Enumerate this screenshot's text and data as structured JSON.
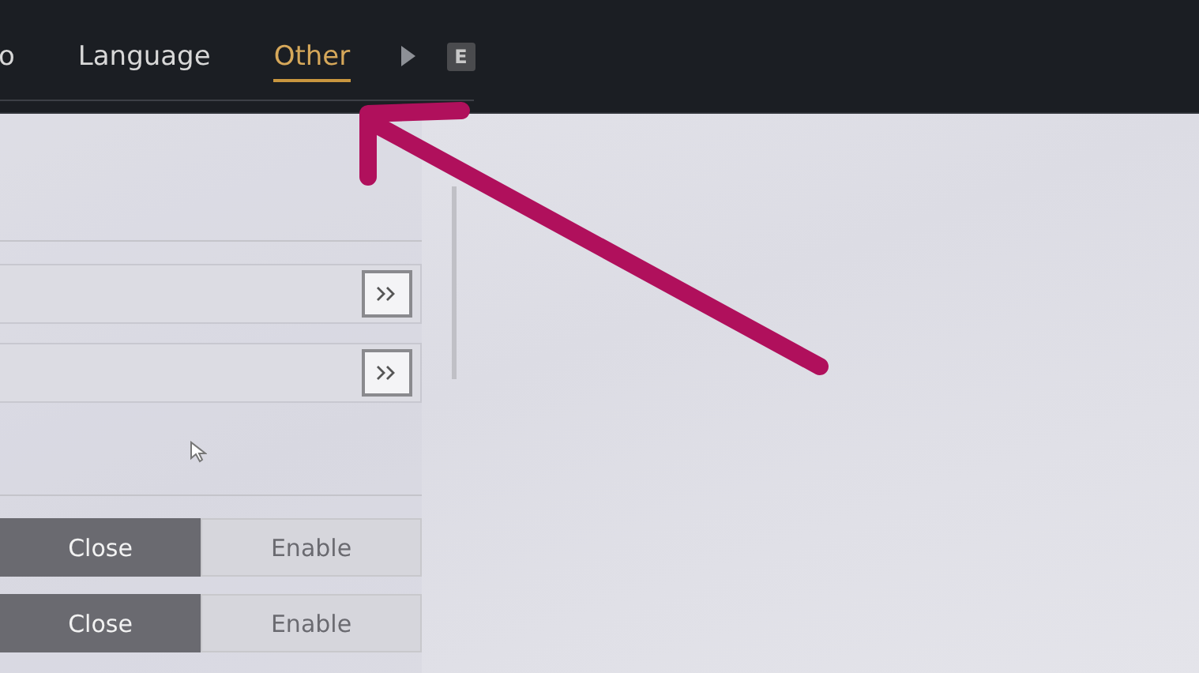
{
  "tabs": [
    {
      "label": "o",
      "selected": false
    },
    {
      "label": "Language",
      "selected": false
    },
    {
      "label": "Other",
      "selected": true
    }
  ],
  "next_key": "E",
  "link_rows": [
    {
      "kind": "link"
    },
    {
      "kind": "link"
    }
  ],
  "toggles": [
    {
      "options": [
        {
          "label": "Close",
          "selected": true
        },
        {
          "label": "Enable",
          "selected": false
        }
      ]
    },
    {
      "options": [
        {
          "label": "Close",
          "selected": true
        },
        {
          "label": "Enable",
          "selected": false
        }
      ]
    }
  ]
}
